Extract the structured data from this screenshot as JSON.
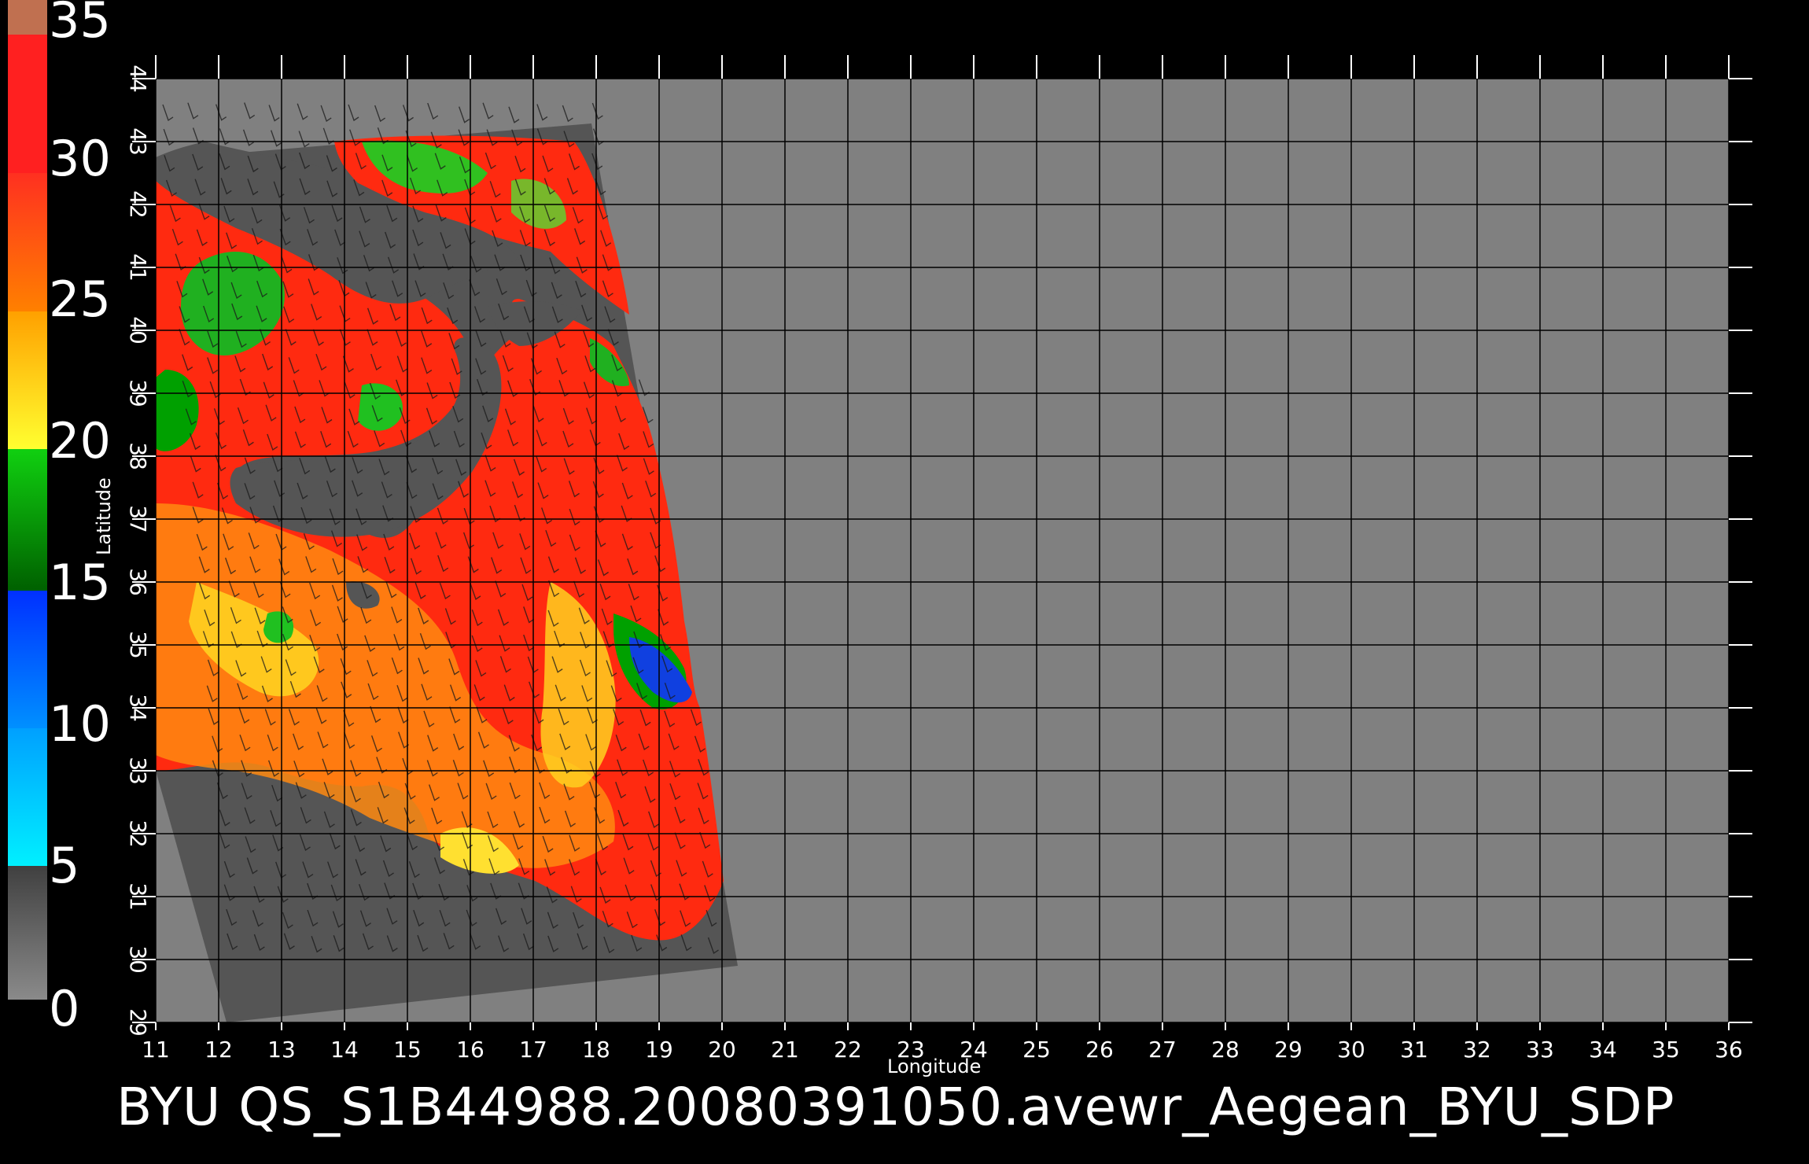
{
  "colorbar": {
    "labels": [
      "35",
      "30",
      "25",
      "20",
      "15",
      "10",
      "5",
      "0"
    ]
  },
  "axes": {
    "xlabel": "Longitude",
    "ylabel": "Latitude",
    "x_range": [
      11,
      36
    ],
    "y_range": [
      29,
      44
    ],
    "x_ticks": [
      "11",
      "12",
      "13",
      "14",
      "15",
      "16",
      "17",
      "18",
      "19",
      "20",
      "21",
      "22",
      "23",
      "24",
      "25",
      "26",
      "27",
      "28",
      "29",
      "30",
      "31",
      "32",
      "33",
      "34",
      "35",
      "36"
    ],
    "y_ticks": [
      "29",
      "30",
      "31",
      "32",
      "33",
      "34",
      "35",
      "36",
      "37",
      "38",
      "39",
      "40",
      "41",
      "42",
      "43",
      "44"
    ]
  },
  "footer": {
    "title": "BYU QS_S1B44988.20080391050.avewr_Aegean_BYU_SDP"
  },
  "colors": {
    "background": "#000000",
    "map_fill": "#808080",
    "swath_fill": "#555555",
    "grid": "#000000"
  }
}
